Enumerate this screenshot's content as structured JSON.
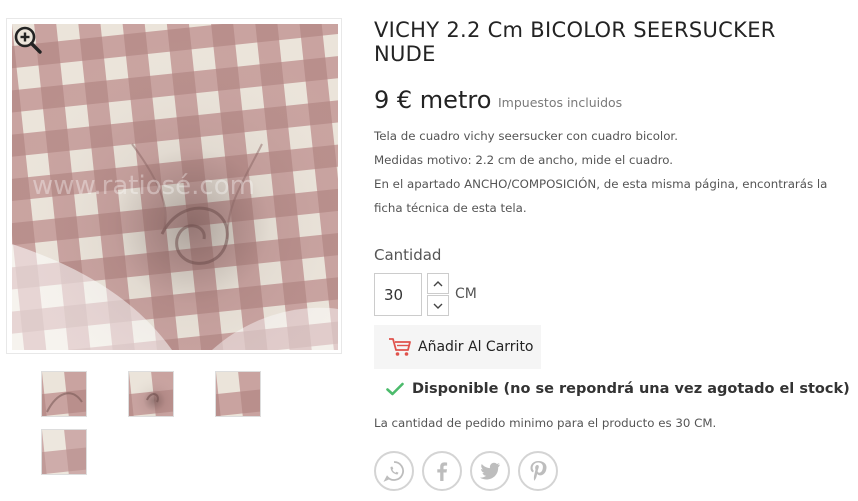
{
  "product": {
    "title": "VICHY 2.2 Cm BICOLOR SEERSUCKER NUDE",
    "price": "9 € metro",
    "tax_note": "Impuestos incluidos",
    "description": [
      "Tela de cuadro vichy seersucker con cuadro bicolor.",
      "Medidas motivo: 2.2 cm de ancho, mide el cuadro.",
      "En el apartado ANCHO/COMPOSICIÓN, de esta misma página, encontrarás la ficha técnica de esta tela."
    ],
    "watermark": "www.ratiosé.com",
    "colors": {
      "check_pink": "#c9a3a0",
      "check_cream": "#ece6dc",
      "availability_check": "#4cbb6c"
    }
  },
  "quantity": {
    "label": "Cantidad",
    "value": "30",
    "unit": "CM",
    "up_icon": "chevron-up-icon",
    "down_icon": "chevron-down-icon"
  },
  "cart": {
    "label": "Añadir Al Carrito",
    "icon": "shopping-cart-icon"
  },
  "availability": {
    "text": "Disponible (no se repondrá una vez agotado el stock)",
    "icon": "check-icon"
  },
  "minimum_order": "La cantidad de pedido minimo para el producto es 30 CM.",
  "social": [
    "whatsapp-icon",
    "facebook-icon",
    "twitter-icon",
    "pinterest-icon"
  ],
  "gallery": {
    "zoom_icon": "zoom-in-icon",
    "thumbnail_count": 4
  }
}
